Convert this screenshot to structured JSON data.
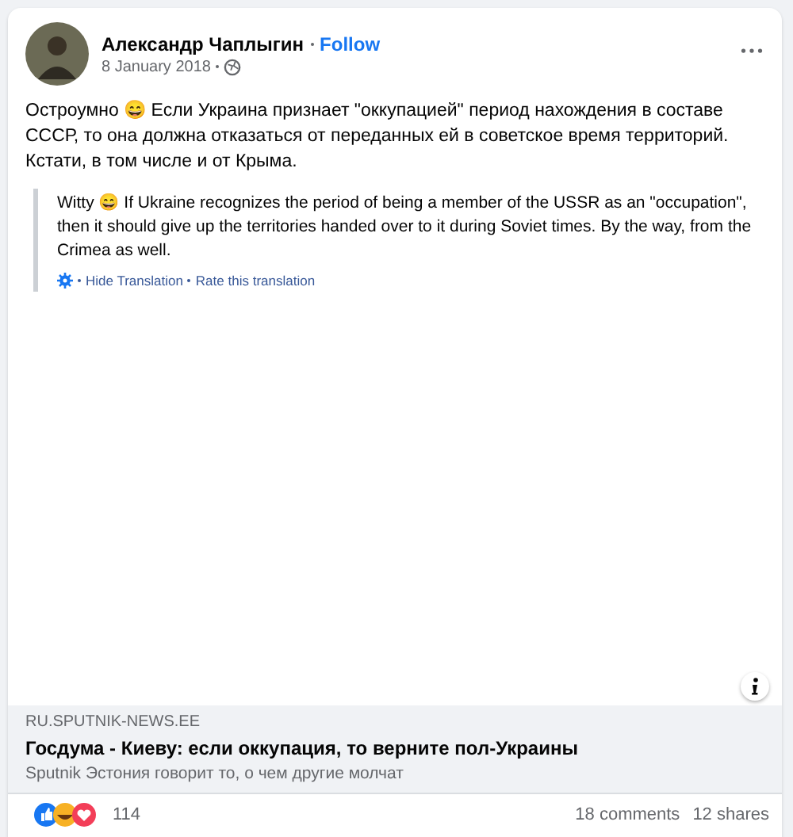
{
  "post": {
    "author": "Александр Чаплыгин",
    "follow": "Follow",
    "date": "8 January 2018",
    "text": "Остроумно 😄 Если Украина признает \"оккупацией\" период нахождения в составе СССР, то она должна отказаться от переданных ей в советское время территорий. Кстати, в том числе и от Крыма.",
    "translation": "Witty 😄 If Ukraine recognizes the period of being a member of the USSR as an \"occupation\", then it should give up the territories handed over to it during Soviet times. By the way, from the Crimea as well.",
    "hide_translation": "Hide Translation",
    "rate_translation": "Rate this translation"
  },
  "link": {
    "domain": "RU.SPUTNIK-NEWS.EE",
    "title": "Госдума - Киеву: если оккупация, то верните пол-Украины",
    "description": "Sputnik Эстония говорит то, о чем другие молчат"
  },
  "footer": {
    "reactions": "114",
    "comments": "18 comments",
    "shares": "12 shares"
  }
}
